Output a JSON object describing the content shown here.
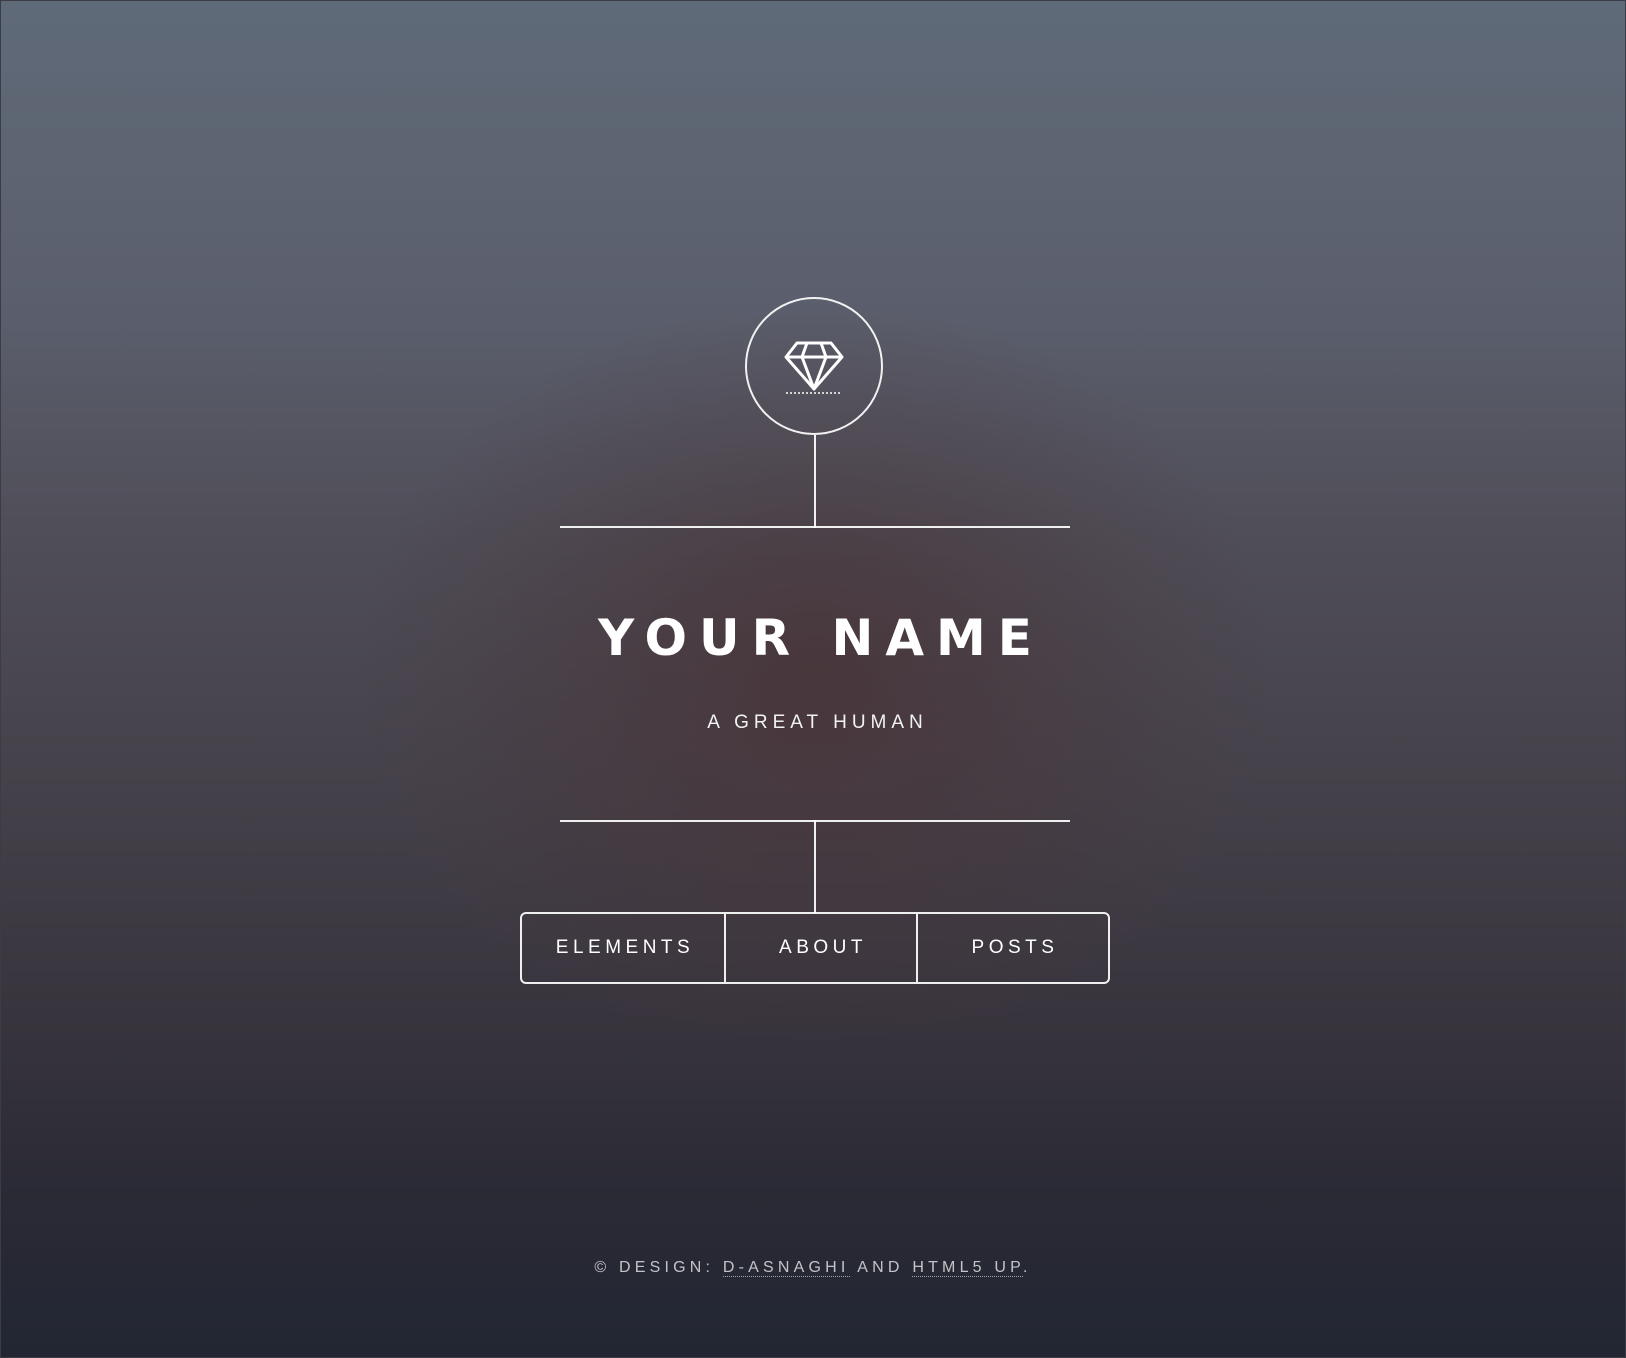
{
  "header": {
    "logo_icon": "diamond-icon",
    "title": "YOUR NAME",
    "subtitle": "A GREAT HUMAN"
  },
  "nav": {
    "items": [
      {
        "label": "ELEMENTS"
      },
      {
        "label": "ABOUT"
      },
      {
        "label": "POSTS"
      }
    ]
  },
  "footer": {
    "prefix": "© DESIGN:",
    "link1": "D-ASNAGHI",
    "middle": "AND",
    "link2": "HTML5 UP",
    "suffix": "."
  },
  "colors": {
    "foreground": "#ffffff",
    "background_top": "#5f6a78",
    "background_bottom": "#222633"
  }
}
